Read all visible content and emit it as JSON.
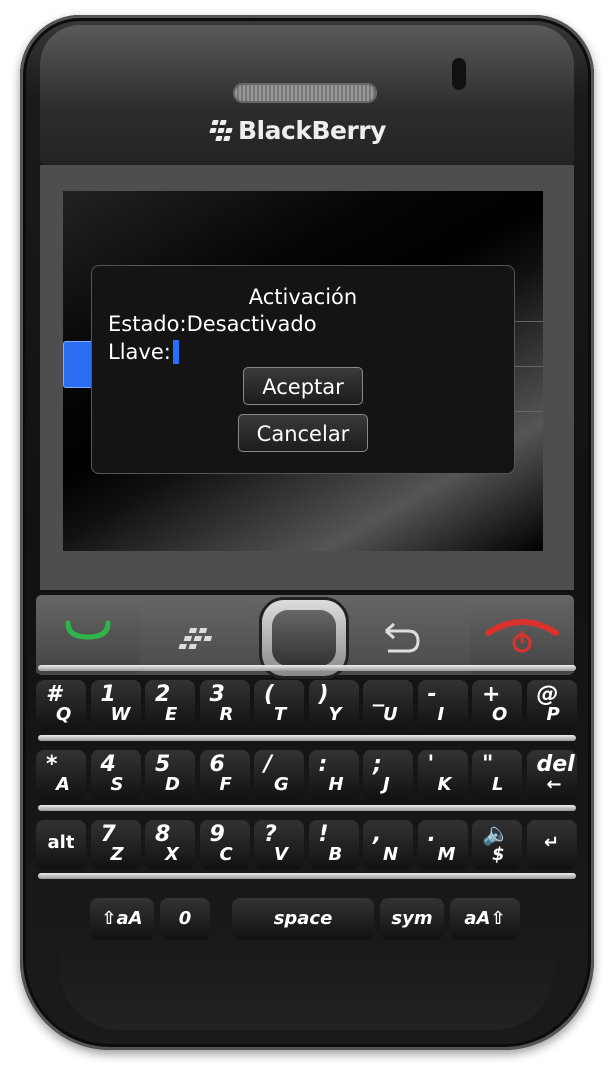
{
  "device": {
    "brand": "BlackBerry"
  },
  "dialog": {
    "title": "Activación",
    "status_text": "Estado:Desactivado",
    "key_label": "Llave:",
    "key_value": "",
    "accept_label": "Aceptar",
    "cancel_label": "Cancelar"
  },
  "keyboard": {
    "rows": [
      [
        {
          "top": "#",
          "bottom": "Q"
        },
        {
          "top": "1",
          "bottom": "W"
        },
        {
          "top": "2",
          "bottom": "E"
        },
        {
          "top": "3",
          "bottom": "R"
        },
        {
          "top": "(",
          "bottom": "T"
        },
        {
          "top": ")",
          "bottom": "Y"
        },
        {
          "top": "_",
          "bottom": "U"
        },
        {
          "top": "-",
          "bottom": "I"
        },
        {
          "top": "+",
          "bottom": "O"
        },
        {
          "top": "@",
          "bottom": "P"
        }
      ],
      [
        {
          "top": "*",
          "bottom": "A"
        },
        {
          "top": "4",
          "bottom": "S"
        },
        {
          "top": "5",
          "bottom": "D"
        },
        {
          "top": "6",
          "bottom": "F"
        },
        {
          "top": "/",
          "bottom": "G"
        },
        {
          "top": ":",
          "bottom": "H"
        },
        {
          "top": ";",
          "bottom": "J"
        },
        {
          "top": "'",
          "bottom": "K"
        },
        {
          "top": "\"",
          "bottom": "L"
        },
        {
          "top": "del",
          "bottom": "←"
        }
      ],
      [
        {
          "top": "alt",
          "bottom": ""
        },
        {
          "top": "7",
          "bottom": "Z"
        },
        {
          "top": "8",
          "bottom": "X"
        },
        {
          "top": "9",
          "bottom": "C"
        },
        {
          "top": "?",
          "bottom": "V"
        },
        {
          "top": "!",
          "bottom": "B"
        },
        {
          "top": ",",
          "bottom": "N"
        },
        {
          "top": ".",
          "bottom": "M"
        },
        {
          "top": "🔈",
          "bottom": "$"
        },
        {
          "top": "↵",
          "bottom": ""
        }
      ]
    ],
    "bottom": {
      "shift_left": "⇧aA",
      "zero": "0",
      "space": "space",
      "sym": "sym",
      "shift_right": "aA⇧"
    }
  },
  "colors": {
    "accent": "#2570ff",
    "call_green": "#2fb44a",
    "end_red": "#d9322b"
  }
}
